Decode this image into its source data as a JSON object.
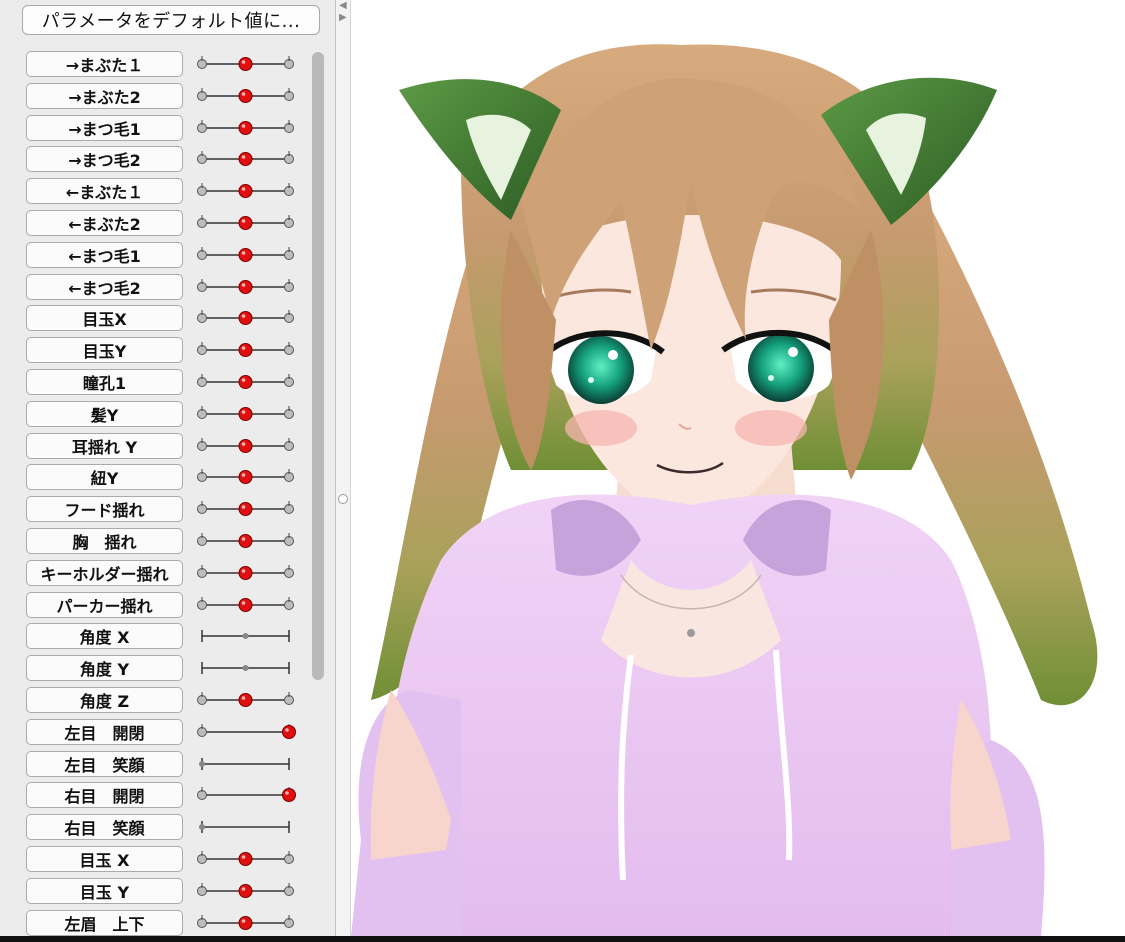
{
  "panel": {
    "reset_button": "パラメータをデフォルト値に...",
    "divider_icons": [
      "triangle-left-icon",
      "triangle-right-icon"
    ],
    "parameters": [
      {
        "label": "→まぶた１",
        "value": 0.5,
        "style": "ball"
      },
      {
        "label": "→まぶた2",
        "value": 0.5,
        "style": "ball"
      },
      {
        "label": "→まつ毛1",
        "value": 0.5,
        "style": "ball"
      },
      {
        "label": "→まつ毛2",
        "value": 0.5,
        "style": "ball"
      },
      {
        "label": "←まぶた１",
        "value": 0.5,
        "style": "ball"
      },
      {
        "label": "←まぶた2",
        "value": 0.5,
        "style": "ball"
      },
      {
        "label": "←まつ毛1",
        "value": 0.5,
        "style": "ball"
      },
      {
        "label": "←まつ毛2",
        "value": 0.5,
        "style": "ball"
      },
      {
        "label": "目玉X",
        "value": 0.5,
        "style": "ball"
      },
      {
        "label": "目玉Y",
        "value": 0.5,
        "style": "ball"
      },
      {
        "label": "瞳孔1",
        "value": 0.5,
        "style": "ball"
      },
      {
        "label": "髪Y",
        "value": 0.5,
        "style": "ball"
      },
      {
        "label": "耳揺れ Y",
        "value": 0.5,
        "style": "ball"
      },
      {
        "label": "紐Y",
        "value": 0.5,
        "style": "ball"
      },
      {
        "label": "フード揺れ",
        "value": 0.5,
        "style": "ball"
      },
      {
        "label": "胸　揺れ",
        "value": 0.5,
        "style": "ball"
      },
      {
        "label": "キーホルダー揺れ",
        "value": 0.5,
        "style": "ball"
      },
      {
        "label": "パーカー揺れ",
        "value": 0.5,
        "style": "ball"
      },
      {
        "label": "角度 X",
        "value": 0.5,
        "style": "dot"
      },
      {
        "label": "角度 Y",
        "value": 0.5,
        "style": "dot"
      },
      {
        "label": "角度 Z",
        "value": 0.5,
        "style": "ball"
      },
      {
        "label": "左目　開閉",
        "value": 1.0,
        "style": "ball"
      },
      {
        "label": "左目　笑顔",
        "value": 0.0,
        "style": "dot"
      },
      {
        "label": "右目　開閉",
        "value": 1.0,
        "style": "ball"
      },
      {
        "label": "右目　笑顔",
        "value": 0.0,
        "style": "dot"
      },
      {
        "label": "目玉 X",
        "value": 0.5,
        "style": "ball"
      },
      {
        "label": "目玉 Y",
        "value": 0.5,
        "style": "ball"
      },
      {
        "label": "左眉　上下",
        "value": 0.5,
        "style": "ball"
      }
    ]
  },
  "colors": {
    "knob": "#e01010",
    "hair": "#c9a077",
    "hair_tip": "#7a9a3a",
    "ear": "#3f7a2f",
    "hoodie": "#e8c8f0",
    "skin": "#fbe6dc",
    "eye": "#1aa583"
  }
}
